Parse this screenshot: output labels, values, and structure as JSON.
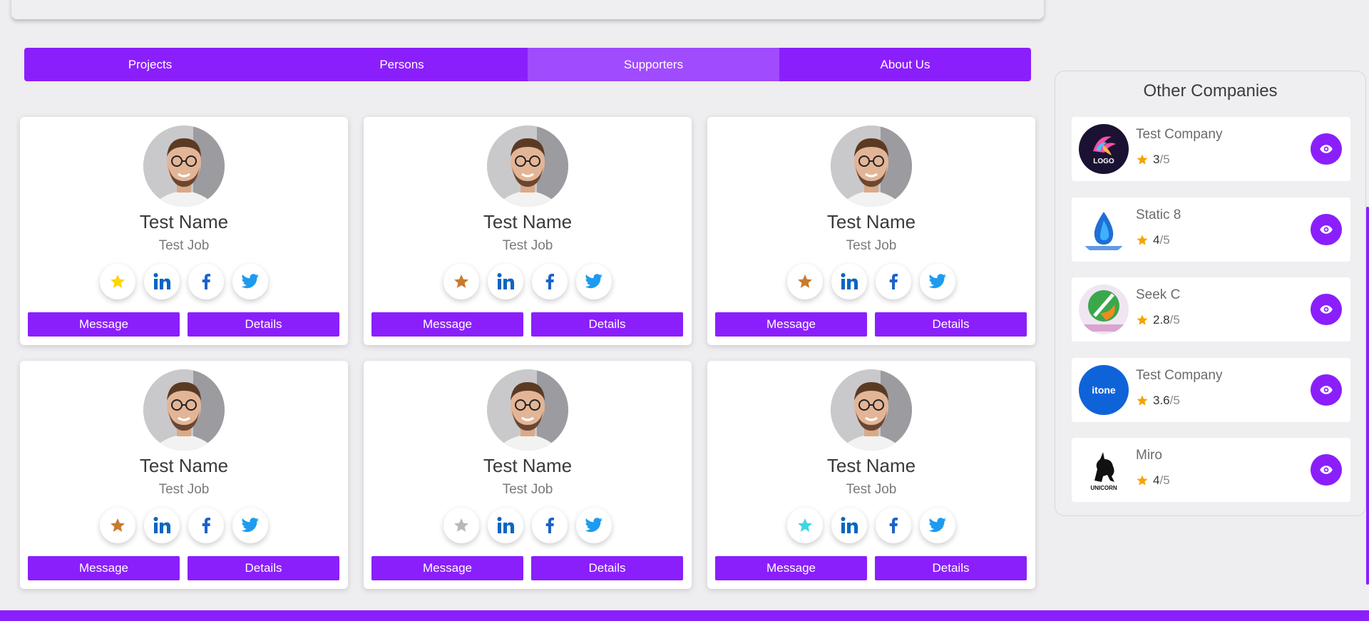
{
  "tabs": [
    {
      "label": "Projects",
      "active": false
    },
    {
      "label": "Persons",
      "active": false
    },
    {
      "label": "Supporters",
      "active": true
    },
    {
      "label": "About Us",
      "active": false
    }
  ],
  "cards": [
    {
      "name": "Test Name",
      "job": "Test Job",
      "star_color": "#ffd400",
      "message_label": "Message",
      "details_label": "Details"
    },
    {
      "name": "Test Name",
      "job": "Test Job",
      "star_color": "#c97a2c",
      "message_label": "Message",
      "details_label": "Details"
    },
    {
      "name": "Test Name",
      "job": "Test Job",
      "star_color": "#c97a2c",
      "message_label": "Message",
      "details_label": "Details"
    },
    {
      "name": "Test Name",
      "job": "Test Job",
      "star_color": "#c97a2c",
      "message_label": "Message",
      "details_label": "Details"
    },
    {
      "name": "Test Name",
      "job": "Test Job",
      "star_color": "#b8b8b8",
      "message_label": "Message",
      "details_label": "Details"
    },
    {
      "name": "Test Name",
      "job": "Test Job",
      "star_color": "#3fd6e6",
      "message_label": "Message",
      "details_label": "Details"
    }
  ],
  "sidebar": {
    "title": "Other Companies",
    "companies": [
      {
        "name": "Test Company",
        "rating": "3",
        "max": "/5",
        "logo": "logo-maker"
      },
      {
        "name": "Static 8",
        "rating": "4",
        "max": "/5",
        "logo": "drop-logo"
      },
      {
        "name": "Seek C",
        "rating": "2.8",
        "max": "/5",
        "logo": "corporate-logo"
      },
      {
        "name": "Test Company",
        "rating": "3.6",
        "max": "/5",
        "logo": "itone-logo"
      },
      {
        "name": "Miro",
        "rating": "4",
        "max": "/5",
        "logo": "unicorn-logo"
      }
    ]
  },
  "logo_texts": {
    "logo_maker": "LOGO",
    "itone": "itone",
    "unicorn": "UNICORN"
  },
  "colors": {
    "accent": "#8a1ffc",
    "accent_active": "#a04bfd",
    "star_rating": "#f5a300"
  }
}
